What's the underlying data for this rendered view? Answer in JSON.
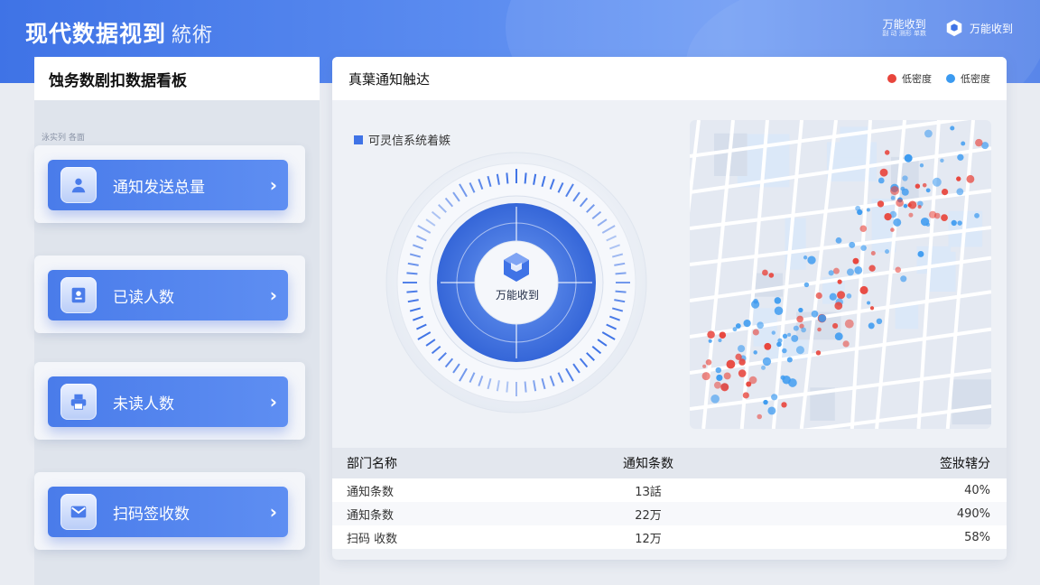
{
  "header": {
    "title": "现代数据视到",
    "subtitle": "統術",
    "top_link": "万能收到",
    "top_link_sub": "副 动 测形 单数",
    "brand": "万能收到"
  },
  "left_panel": {
    "title": "蚀务数剧扣数据看板",
    "caption": "泳实列 各面",
    "cards": [
      {
        "label": "通知发送总量",
        "icon": "user-icon"
      },
      {
        "label": "已读人数",
        "icon": "id-card-icon"
      },
      {
        "label": "未读人数",
        "icon": "printer-icon"
      },
      {
        "label": "扫码签收数",
        "icon": "mail-icon"
      }
    ],
    "chevron": "›"
  },
  "main_panel": {
    "title": "真葉通知触达",
    "legend": [
      {
        "label": "低密度",
        "color": "#e8453c"
      },
      {
        "label": "低密度",
        "color": "#3b9af0"
      }
    ],
    "section_label": "可灵信系统着嫉",
    "center_label": "万能收到",
    "table": {
      "headers": [
        "部门名称",
        "通知条数",
        "签妝辖分"
      ],
      "rows": [
        [
          "通知条数",
          "1З話",
          "40%"
        ],
        [
          "通知条数",
          "22万",
          "490%"
        ],
        [
          "扫码 收数",
          "12万",
          "58%"
        ]
      ]
    }
  },
  "colors": {
    "accent": "#4a7cea",
    "red_dot": "#e8453c",
    "blue_dot": "#3b9af0"
  }
}
